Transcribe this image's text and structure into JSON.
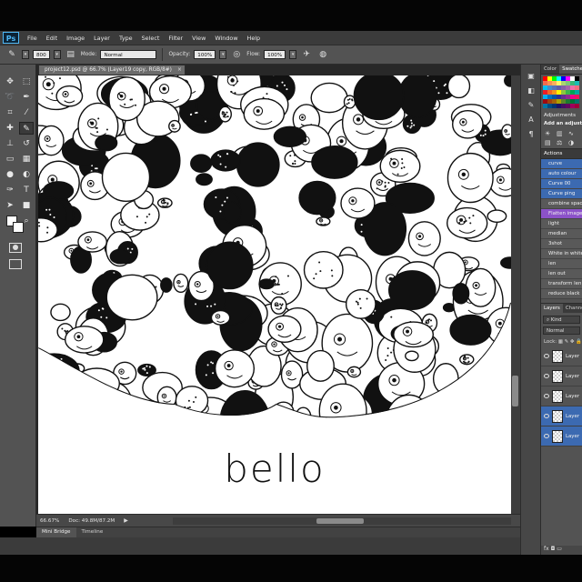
{
  "app": {
    "logo": "Ps"
  },
  "menu": [
    "File",
    "Edit",
    "Image",
    "Layer",
    "Type",
    "Select",
    "Filter",
    "View",
    "Window",
    "Help"
  ],
  "options_bar": {
    "brush_size": "800",
    "mode_label": "Mode:",
    "mode_value": "Normal",
    "opacity_label": "Opacity:",
    "opacity_value": "100%",
    "flow_label": "Flow:",
    "flow_value": "100%"
  },
  "document": {
    "tab_title": "project12.psd @ 66.7% (Layer19 copy, RGB/8#)",
    "canvas_text": "bello",
    "zoom": "66.67%",
    "doc_size": "Doc: 49.8M/87.2M"
  },
  "bottom_tabs": [
    "Mini Bridge",
    "Timeline"
  ],
  "color_panel": {
    "tabs": [
      "Color",
      "Swatches"
    ],
    "swatch_colors": [
      "#ff0000",
      "#ffff00",
      "#00ff00",
      "#00ffff",
      "#0000ff",
      "#ff00ff",
      "#ffffff",
      "#000000",
      "#f26c4f",
      "#f68e56",
      "#fbaf5d",
      "#fff467",
      "#acd372",
      "#7cc576",
      "#3bb878",
      "#1abbb4",
      "#00bff3",
      "#438cca",
      "#5574b9",
      "#605ca8",
      "#855fa8",
      "#a763a8",
      "#f06ea9",
      "#f26d7d",
      "#ed1c24",
      "#f26522",
      "#f7941d",
      "#fff200",
      "#8dc63f",
      "#39b54a",
      "#00a651",
      "#00a99d",
      "#00aeef",
      "#0072bc",
      "#0054a6",
      "#2e3192",
      "#662d91",
      "#92278f",
      "#ec008c",
      "#ed145b",
      "#9e0b0f",
      "#a0410d",
      "#a36209",
      "#aba000",
      "#598527",
      "#1a7b30",
      "#007236",
      "#00746b",
      "#0076a3",
      "#004b80",
      "#003471",
      "#1b1464",
      "#440e62",
      "#630460",
      "#9e005d",
      "#9e0039"
    ]
  },
  "adjustments": {
    "title": "Adjustments",
    "subtitle": "Add an adjustment"
  },
  "actions": {
    "title": "Actions",
    "items": [
      {
        "label": "curve",
        "style": "blue"
      },
      {
        "label": "auto colour",
        "style": "blue"
      },
      {
        "label": "Curve 00",
        "style": "blue"
      },
      {
        "label": "Curve ping",
        "style": "blue"
      },
      {
        "label": "combine spac",
        "style": "plain"
      },
      {
        "label": "Flatten image",
        "style": "purple"
      },
      {
        "label": "light",
        "style": "plain"
      },
      {
        "label": "median",
        "style": "plain"
      },
      {
        "label": "3shot",
        "style": "plain"
      },
      {
        "label": "White in white",
        "style": "plain"
      },
      {
        "label": "len",
        "style": "plain"
      },
      {
        "label": "len out",
        "style": "plain"
      },
      {
        "label": "transform len",
        "style": "plain"
      },
      {
        "label": "reduce black",
        "style": "plain"
      }
    ]
  },
  "layers": {
    "tabs": [
      "Layers",
      "Channels"
    ],
    "kind": "Kind",
    "blend": "Normal",
    "lock": "Lock:",
    "items": [
      {
        "name": "Layer",
        "selected": false
      },
      {
        "name": "Layer",
        "selected": false
      },
      {
        "name": "Layer",
        "selected": false
      },
      {
        "name": "Layer",
        "selected": true
      },
      {
        "name": "Layer",
        "selected": true
      }
    ],
    "footer": "fx"
  }
}
